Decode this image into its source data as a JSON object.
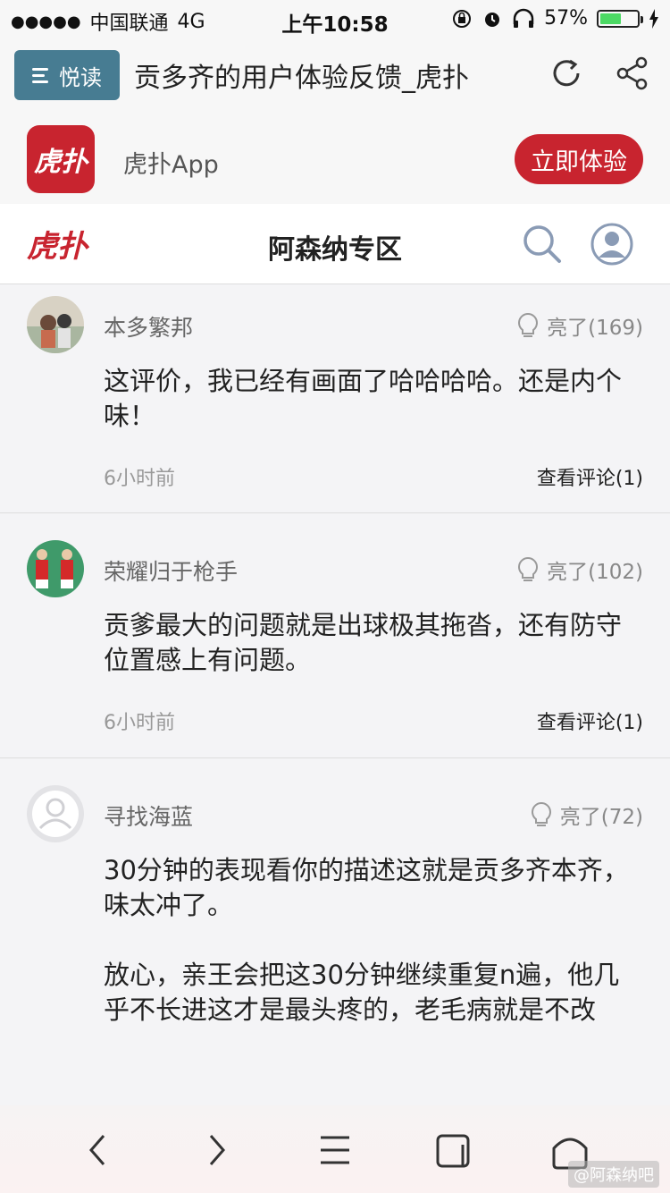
{
  "status_bar": {
    "signal_dots": "●●●●●",
    "carrier": "中国联通",
    "network": "4G",
    "time": "上午10:58",
    "battery_percent": "57%",
    "battery_level": 0.57
  },
  "browser": {
    "reader_label": "悦读",
    "page_title": "贡多齐的用户体验反馈_虎扑"
  },
  "app_banner": {
    "logo_text": "虎扑",
    "app_name": "虎扑App",
    "cta_label": "立即体验"
  },
  "site_header": {
    "logo_text": "虎扑",
    "title": "阿森纳专区"
  },
  "comments": [
    {
      "username": "本多繁邦",
      "likes": "亮了(169)",
      "text": "这评价，我已经有画面了哈哈哈哈。还是内个味！",
      "time": "6小时前",
      "view_replies": "查看评论(1)"
    },
    {
      "username": "荣耀归于枪手",
      "likes": "亮了(102)",
      "text": "贡爹最大的问题就是出球极其拖沓，还有防守位置感上有问题。",
      "time": "6小时前",
      "view_replies": "查看评论(1)"
    },
    {
      "username": "寻找海蓝",
      "likes": "亮了(72)",
      "text": "30分钟的表现看你的描述这就是贡多齐本齐，味太冲了。\n\n放心，亲王会把这30分钟继续重复n遍，他几乎不长进这才是最头疼的，老毛病就是不改"
    }
  ],
  "watermark": "@阿森纳吧",
  "colors": {
    "brand_red": "#c8242f",
    "reader_blue": "#477c92",
    "battery_green": "#4cd964"
  },
  "icons": {
    "status": [
      "lock-rotation-icon",
      "alarm-icon",
      "headphones-icon",
      "battery-icon",
      "charging-icon"
    ],
    "browser": [
      "refresh-icon",
      "share-icon"
    ],
    "header": [
      "search-icon",
      "user-icon"
    ],
    "comment": [
      "lightbulb-icon"
    ],
    "toolbar": [
      "back-icon",
      "forward-icon",
      "menu-icon",
      "tabs-icon",
      "home-icon"
    ]
  }
}
